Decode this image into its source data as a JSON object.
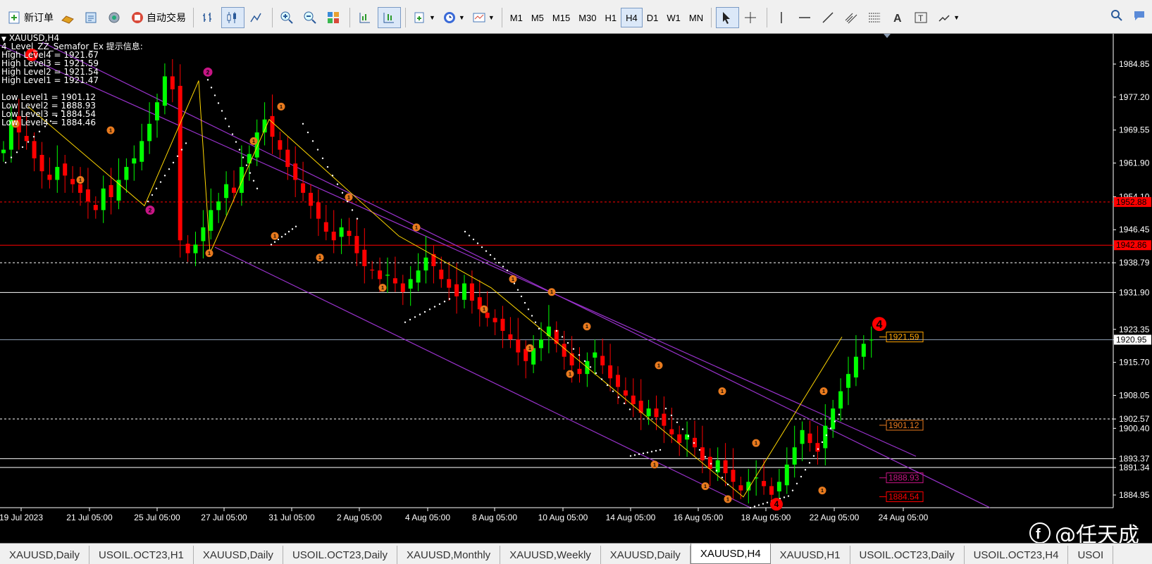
{
  "toolbar": {
    "new_order_label": "新订单",
    "auto_trade_label": "自动交易",
    "timeframes": [
      "M1",
      "M5",
      "M15",
      "M30",
      "H1",
      "H4",
      "D1",
      "W1",
      "MN"
    ],
    "active_timeframe": "H4"
  },
  "chart": {
    "symbol_label": "XAUUSD,H4",
    "indicator_title": "4_Level_ZZ_Semafor_Ex 提示信息:",
    "high_levels": [
      "High Level4 = 1921.67",
      "High Level3 = 1921.59",
      "High Level2 = 1921.54",
      "High Level1 = 1921.47"
    ],
    "low_levels": [
      "Low Level1 = 1901.12",
      "Low Level2 = 1888.93",
      "Low Level3 = 1884.54",
      "Low Level4 = 1884.46"
    ],
    "price_ticks": [
      "1984.85",
      "1977.20",
      "1969.55",
      "1961.90",
      "1954.10",
      "1946.45",
      "1938.79",
      "1931.90",
      "1923.35",
      "1920.95",
      "1915.70",
      "1908.05",
      "1902.57",
      "1900.40",
      "1893.37",
      "1891.34",
      "1884.95"
    ],
    "time_ticks": [
      "19 Jul 2023",
      "21 Jul 05:00",
      "25 Jul 05:00",
      "27 Jul 05:00",
      "31 Jul 05:00",
      "2 Aug 05:00",
      "4 Aug 05:00",
      "8 Aug 05:00",
      "10 Aug 05:00",
      "14 Aug 05:00",
      "16 Aug 05:00",
      "18 Aug 05:00",
      "22 Aug 05:00",
      "24 Aug 05:00"
    ],
    "line_labels": {
      "red_dashed": "1952.88",
      "red_solid": "1942.86",
      "current": "1920.95",
      "high_box": "1921.59",
      "low1_box": "1901.12",
      "low2_box": "1888.93",
      "low3_box": "1884.54"
    },
    "semafor_big": "4",
    "colors": {
      "bull": "#00ff00",
      "bear": "#ff0000",
      "channel": "#9932cc",
      "zigzag": "#ffd700",
      "level_red": "#ff0000"
    }
  },
  "watermark": {
    "text": "@任天成",
    "icon": "facebook-like-icon"
  },
  "tabs": [
    "XAUUSD,Daily",
    "USOIL.OCT23,H1",
    "XAUUSD,Daily",
    "USOIL.OCT23,Daily",
    "XAUUSD,Monthly",
    "XAUUSD,Weekly",
    "XAUUSD,Daily",
    "XAUUSD,H4",
    "XAUUSD,H1",
    "USOIL.OCT23,Daily",
    "USOIL.OCT23,H4",
    "USOI"
  ],
  "active_tab": "XAUUSD,H4"
}
